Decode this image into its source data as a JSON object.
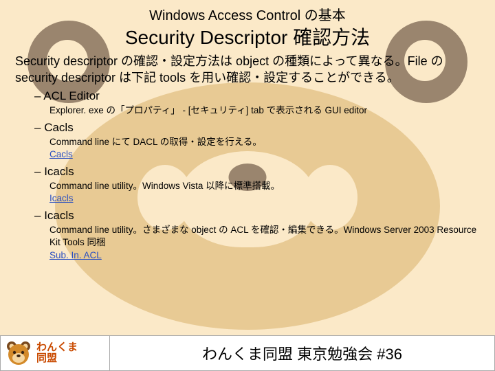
{
  "supertitle": "Windows Access Control の基本",
  "title": "Security Descriptor 確認方法",
  "lead": "Security descriptor の確認・設定方法は object の種類によって異なる。File の security descriptor は下記 tools を用い確認・設定することができる。",
  "tools": [
    {
      "name": "ACL Editor",
      "desc": "Explorer. exe の「プロパティ」 - [セキュリティ] tab で表示される GUI editor",
      "link": null
    },
    {
      "name": "Cacls",
      "desc": "Command line にて DACL の取得・設定を行える。",
      "link": "Cacls"
    },
    {
      "name": "Icacls",
      "desc": "Command line utility。Windows Vista 以降に標準搭載。",
      "link": "Icacls"
    },
    {
      "name": "Icacls",
      "desc": "Command line utility。さまざまな object の ACL を確認・編集できる。Windows Server 2003 Resource Kit Tools 同梱",
      "link": "Sub. In. ACL"
    }
  ],
  "badge": {
    "line1": "わんくま",
    "line2": "同盟"
  },
  "footer": "わんくま同盟 東京勉強会 #36"
}
